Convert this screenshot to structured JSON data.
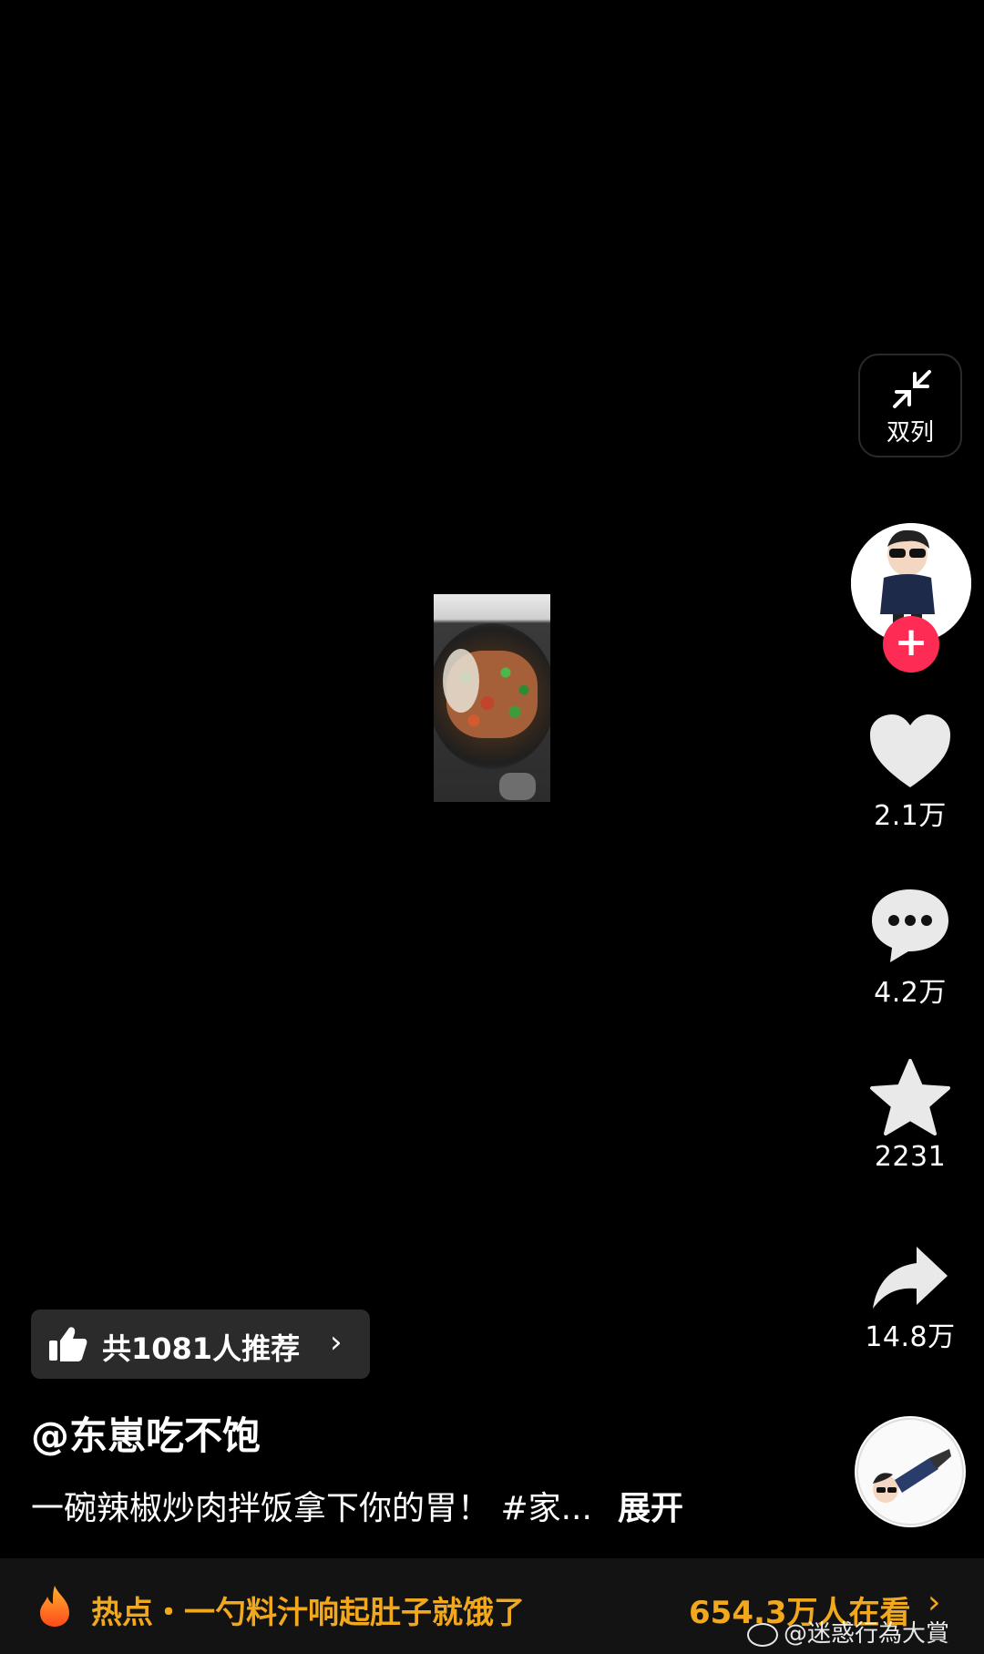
{
  "side_panel": {
    "dual_column_label": "双列",
    "like_count": "2.1万",
    "comment_count": "4.2万",
    "favorite_count": "2231",
    "share_count": "14.8万",
    "follow_symbol": "+"
  },
  "recommend": {
    "text": "共1081人推荐",
    "chevron": "›"
  },
  "post": {
    "author": "@东崽吃不饱",
    "description": "一碗辣椒炒肉拌饭拿下你的胃！ #家...",
    "expand_label": "展开"
  },
  "hot_bar": {
    "text": "热点・一勺料汁响起肚子就饿了",
    "viewers": "654.3万人在看",
    "chevron": "›"
  },
  "watermark": {
    "text": "@迷惑行為大賞"
  },
  "colors": {
    "background": "#000000",
    "follow_button": "#fe2c55",
    "hot_accent": "#f2a81d"
  },
  "icons": [
    "minimize-arrows-icon",
    "heart-icon",
    "comment-icon",
    "star-icon",
    "share-icon",
    "thumbs-up-icon",
    "flame-icon",
    "weibo-icon"
  ]
}
